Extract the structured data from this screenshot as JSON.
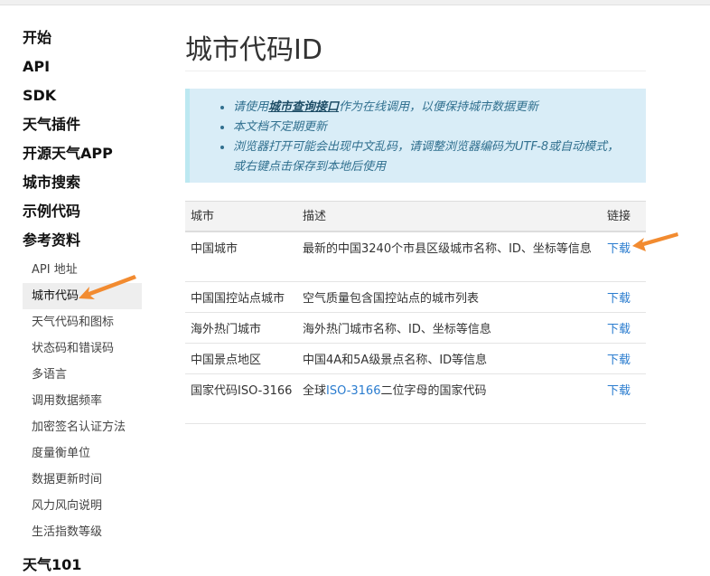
{
  "sidebar": {
    "top_items": [
      {
        "label": "开始"
      },
      {
        "label": "API"
      },
      {
        "label": "SDK"
      },
      {
        "label": "天气插件"
      },
      {
        "label": "开源天气APP"
      },
      {
        "label": "城市搜索"
      },
      {
        "label": "示例代码"
      },
      {
        "label": "参考资料"
      }
    ],
    "sub_items": [
      {
        "label": "API 地址"
      },
      {
        "label": "城市代码"
      },
      {
        "label": "天气代码和图标"
      },
      {
        "label": "状态码和错误码"
      },
      {
        "label": "多语言"
      },
      {
        "label": "调用数据频率"
      },
      {
        "label": "加密签名认证方法"
      },
      {
        "label": "度量衡单位"
      },
      {
        "label": "数据更新时间"
      },
      {
        "label": "风力风向说明"
      },
      {
        "label": "生活指数等级"
      }
    ],
    "active_sub": "城市代码",
    "last_item": "天气101"
  },
  "main": {
    "title": "城市代码ID",
    "notice": {
      "item1_prefix": "请使用",
      "item1_link": "城市查询接口",
      "item1_suffix": "作为在线调用，以便保持城市数据更新",
      "item2": "本文档不定期更新",
      "item3": "浏览器打开可能会出现中文乱码，请调整浏览器编码为UTF-8或自动模式，或右键点击保存到本地后使用"
    },
    "table": {
      "headers": {
        "city": "城市",
        "desc": "描述",
        "link": "链接"
      },
      "rows": [
        {
          "city": "中国城市",
          "desc": "最新的中国3240个市县区级城市名称、ID、坐标等信息",
          "link": "下载"
        },
        {
          "city": "中国国控站点城市",
          "desc": "空气质量包含国控站点的城市列表",
          "link": "下载"
        },
        {
          "city": "海外热门城市",
          "desc": "海外热门城市名称、ID、坐标等信息",
          "link": "下载"
        },
        {
          "city": "中国景点地区",
          "desc": "中国4A和5A级景点名称、ID等信息",
          "link": "下载"
        },
        {
          "city": "国家代码ISO-3166",
          "desc_prefix": "全球",
          "desc_link": "ISO-3166",
          "desc_suffix": "二位字母的国家代码",
          "link": "下载"
        }
      ]
    }
  },
  "colors": {
    "accent_link": "#2a7ccf",
    "notice_bg": "#d9edf7",
    "notice_text": "#31708f",
    "arrow": "#f28b30"
  },
  "icons": [
    "annotation-arrow"
  ]
}
